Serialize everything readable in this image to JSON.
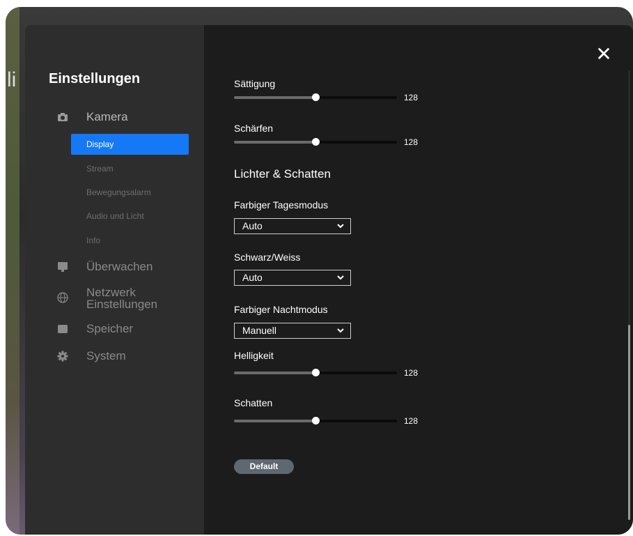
{
  "background": {
    "partial_text": "li"
  },
  "sidebar": {
    "title": "Einstellungen",
    "categories": [
      {
        "label": "Kamera",
        "icon": "camera-icon"
      },
      {
        "label": "Überwachen",
        "icon": "monitor-icon"
      },
      {
        "label": "Netzwerk\nEinstellungen",
        "icon": "globe-icon"
      },
      {
        "label": "Speicher",
        "icon": "storage-icon"
      },
      {
        "label": "System",
        "icon": "gear-icon"
      }
    ],
    "subitems": [
      {
        "label": "Display",
        "active": true
      },
      {
        "label": "Stream"
      },
      {
        "label": "Bewegungsalarm"
      },
      {
        "label": "Audio und Licht"
      },
      {
        "label": "Info"
      }
    ],
    "active_color": "#1578f5"
  },
  "content": {
    "close_icon": "close-icon",
    "saettigung": {
      "label": "Sättigung",
      "value": "128",
      "fraction": 0.5
    },
    "schaerfen": {
      "label": "Schärfen",
      "value": "128",
      "fraction": 0.5
    },
    "section_title": "Lichter & Schatten",
    "farbiger_tagesmodus": {
      "label": "Farbiger Tagesmodus",
      "selected": "Auto"
    },
    "schwarz_weiss": {
      "label": "Schwarz/Weiss",
      "selected": "Auto"
    },
    "farbiger_nachtmodus": {
      "label": "Farbiger Nachtmodus",
      "selected": "Manuell"
    },
    "helligkeit": {
      "label": "Helligkeit",
      "value": "128",
      "fraction": 0.5
    },
    "schatten": {
      "label": "Schatten",
      "value": "128",
      "fraction": 0.5
    },
    "default_button": "Default"
  }
}
